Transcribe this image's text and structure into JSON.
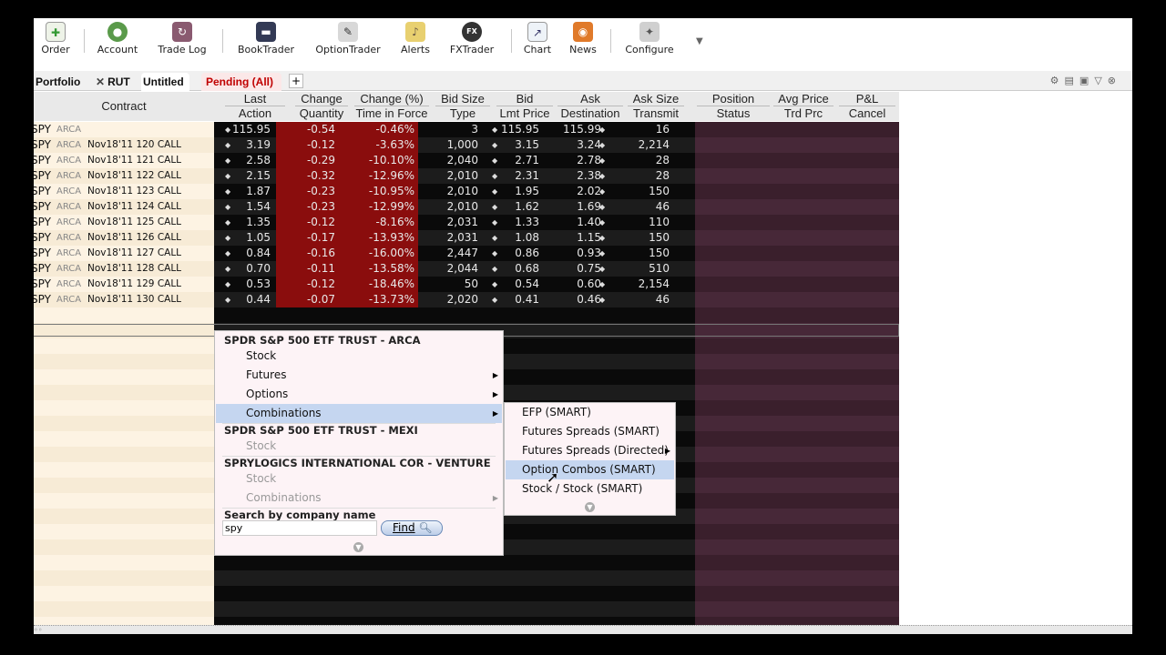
{
  "toolbar": {
    "buttons": [
      {
        "label": "Order",
        "icon": "order-icon"
      },
      {
        "label": "Account",
        "icon": "account-icon"
      },
      {
        "label": "Trade Log",
        "icon": "trade-log-icon"
      },
      {
        "label": "BookTrader",
        "icon": "booktrader-icon"
      },
      {
        "label": "OptionTrader",
        "icon": "optiontrader-icon"
      },
      {
        "label": "Alerts",
        "icon": "alerts-icon"
      },
      {
        "label": "FXTrader",
        "icon": "fxtrader-icon"
      },
      {
        "label": "Chart",
        "icon": "chart-icon"
      },
      {
        "label": "News",
        "icon": "news-icon"
      },
      {
        "label": "Configure",
        "icon": "configure-icon"
      }
    ],
    "fx_glyph": "FX"
  },
  "tabs": {
    "items": [
      "Portfolio",
      "RUT",
      "Untitled",
      "Pending (All)"
    ],
    "add": "+",
    "close_glyph": "✕"
  },
  "columns": {
    "contract": "Contract",
    "top": [
      "Last",
      "Change",
      "Change (%)",
      "Bid Size",
      "Bid",
      "Ask",
      "Ask Size",
      "Position",
      "Avg Price",
      "P&L"
    ],
    "bottom": [
      "Action",
      "Quantity",
      "Time in Force",
      "Type",
      "Lmt Price",
      "Destination",
      "Transmit",
      "Status",
      "Trd Prc",
      "Cancel"
    ]
  },
  "rows": [
    {
      "sym": "SPY",
      "exch": "ARCA",
      "desc": "",
      "last": "115.95",
      "change": "-0.54",
      "pct": "-0.46%",
      "bidsize": "3",
      "bid": "115.95",
      "ask": "115.99",
      "asksize": "16"
    },
    {
      "sym": "SPY",
      "exch": "ARCA",
      "desc": "Nov18'11 120 CALL",
      "last": "3.19",
      "change": "-0.12",
      "pct": "-3.63%",
      "bidsize": "1,000",
      "bid": "3.15",
      "ask": "3.24",
      "asksize": "2,214"
    },
    {
      "sym": "SPY",
      "exch": "ARCA",
      "desc": "Nov18'11 121 CALL",
      "last": "2.58",
      "change": "-0.29",
      "pct": "-10.10%",
      "bidsize": "2,040",
      "bid": "2.71",
      "ask": "2.78",
      "asksize": "28"
    },
    {
      "sym": "SPY",
      "exch": "ARCA",
      "desc": "Nov18'11 122 CALL",
      "last": "2.15",
      "change": "-0.32",
      "pct": "-12.96%",
      "bidsize": "2,010",
      "bid": "2.31",
      "ask": "2.38",
      "asksize": "28"
    },
    {
      "sym": "SPY",
      "exch": "ARCA",
      "desc": "Nov18'11 123 CALL",
      "last": "1.87",
      "change": "-0.23",
      "pct": "-10.95%",
      "bidsize": "2,010",
      "bid": "1.95",
      "ask": "2.02",
      "asksize": "150"
    },
    {
      "sym": "SPY",
      "exch": "ARCA",
      "desc": "Nov18'11 124 CALL",
      "last": "1.54",
      "change": "-0.23",
      "pct": "-12.99%",
      "bidsize": "2,010",
      "bid": "1.62",
      "ask": "1.69",
      "asksize": "46"
    },
    {
      "sym": "SPY",
      "exch": "ARCA",
      "desc": "Nov18'11 125 CALL",
      "last": "1.35",
      "change": "-0.12",
      "pct": "-8.16%",
      "bidsize": "2,031",
      "bid": "1.33",
      "ask": "1.40",
      "asksize": "110"
    },
    {
      "sym": "SPY",
      "exch": "ARCA",
      "desc": "Nov18'11 126 CALL",
      "last": "1.05",
      "change": "-0.17",
      "pct": "-13.93%",
      "bidsize": "2,031",
      "bid": "1.08",
      "ask": "1.15",
      "asksize": "150"
    },
    {
      "sym": "SPY",
      "exch": "ARCA",
      "desc": "Nov18'11 127 CALL",
      "last": "0.84",
      "change": "-0.16",
      "pct": "-16.00%",
      "bidsize": "2,447",
      "bid": "0.86",
      "ask": "0.93",
      "asksize": "150"
    },
    {
      "sym": "SPY",
      "exch": "ARCA",
      "desc": "Nov18'11 128 CALL",
      "last": "0.70",
      "change": "-0.11",
      "pct": "-13.58%",
      "bidsize": "2,044",
      "bid": "0.68",
      "ask": "0.75",
      "asksize": "510"
    },
    {
      "sym": "SPY",
      "exch": "ARCA",
      "desc": "Nov18'11 129 CALL",
      "last": "0.53",
      "change": "-0.12",
      "pct": "-18.46%",
      "bidsize": "50",
      "bid": "0.54",
      "ask": "0.60",
      "asksize": "2,154"
    },
    {
      "sym": "SPY",
      "exch": "ARCA",
      "desc": "Nov18'11 130 CALL",
      "last": "0.44",
      "change": "-0.07",
      "pct": "-13.73%",
      "bidsize": "2,020",
      "bid": "0.41",
      "ask": "0.46",
      "asksize": "46"
    }
  ],
  "menu": {
    "header1": "SPDR S&P 500 ETF TRUST - ARCA",
    "items1": [
      {
        "label": "Stock",
        "submenu": false,
        "disabled": false
      },
      {
        "label": "Futures",
        "submenu": true,
        "disabled": false
      },
      {
        "label": "Options",
        "submenu": true,
        "disabled": false
      },
      {
        "label": "Combinations",
        "submenu": true,
        "disabled": false,
        "highlighted": true
      }
    ],
    "header2": "SPDR S&P 500 ETF TRUST - MEXI",
    "items2": [
      {
        "label": "Stock",
        "disabled": true
      }
    ],
    "header3": "SPRYLOGICS INTERNATIONAL COR - VENTURE",
    "items3": [
      {
        "label": "Stock",
        "submenu": false,
        "disabled": true
      },
      {
        "label": "Combinations",
        "submenu": true,
        "disabled": true
      }
    ],
    "search_label": "Search by company name",
    "search_value": "spy",
    "find_label": "Find"
  },
  "submenu": {
    "items": [
      {
        "label": "EFP (SMART)",
        "submenu": false
      },
      {
        "label": "Futures Spreads (SMART)",
        "submenu": false
      },
      {
        "label": "Futures Spreads (Directed)",
        "submenu": true
      },
      {
        "label": "Option Combos (SMART)",
        "submenu": false,
        "highlighted": true
      },
      {
        "label": "Stock / Stock (SMART)",
        "submenu": false
      }
    ]
  },
  "colors": {
    "change_bg": "#8a0d0d",
    "data_bg": "#0a0a0a",
    "position_bg": "#3a1f2c",
    "contract_bg": "#fdf3e3",
    "menu_bg": "#fdf3f6",
    "highlight": "#c5d6f0",
    "pending_tab": "#c00000"
  }
}
